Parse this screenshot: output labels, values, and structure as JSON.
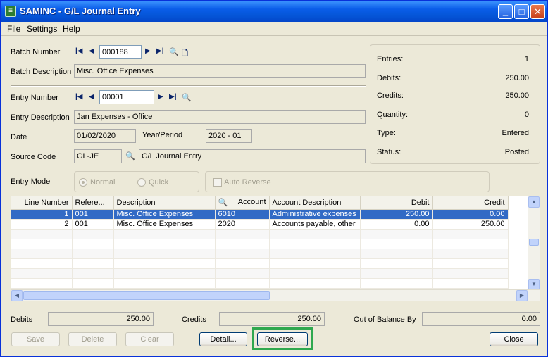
{
  "window": {
    "title": "SAMINC - G/L Journal Entry",
    "icon_text": "≡"
  },
  "menu": [
    "File",
    "Settings",
    "Help"
  ],
  "batch": {
    "number_label": "Batch Number",
    "number": "000188",
    "desc_label": "Batch Description",
    "description": "Misc. Office Expenses"
  },
  "entry": {
    "number_label": "Entry Number",
    "number": "00001",
    "desc_label": "Entry Description",
    "description": "Jan Expenses - Office",
    "date_label": "Date",
    "date": "01/02/2020",
    "period_label": "Year/Period",
    "period": "2020 - 01",
    "source_label": "Source Code",
    "source_code": "GL-JE",
    "source_desc": "G/L Journal Entry",
    "mode_label": "Entry Mode",
    "mode_normal": "Normal",
    "mode_quick": "Quick",
    "auto_reverse": "Auto Reverse"
  },
  "summary": {
    "entries_label": "Entries:",
    "entries": "1",
    "debits_label": "Debits:",
    "debits": "250.00",
    "credits_label": "Credits:",
    "credits": "250.00",
    "quantity_label": "Quantity:",
    "quantity": "0",
    "type_label": "Type:",
    "type": "Entered",
    "status_label": "Status:",
    "status": "Posted"
  },
  "grid": {
    "headers": [
      "Line Number",
      "Refere...",
      "Description",
      "Account",
      "Account Description",
      "Debit",
      "Credit"
    ],
    "rows": [
      [
        "1",
        "001",
        "Misc. Office Expenses",
        "6010",
        "Administrative expenses",
        "250.00",
        "0.00"
      ],
      [
        "2",
        "001",
        "Misc. Office Expenses",
        "2020",
        "Accounts payable, other",
        "0.00",
        "250.00"
      ]
    ]
  },
  "totals": {
    "debits_label": "Debits",
    "debits": "250.00",
    "credits_label": "Credits",
    "credits": "250.00",
    "oob_label": "Out of Balance By",
    "oob": "0.00"
  },
  "buttons": {
    "save": "Save",
    "delete": "Delete",
    "clear": "Clear",
    "detail": "Detail...",
    "reverse": "Reverse...",
    "close": "Close"
  },
  "colors": {
    "highlight": "#2fa84f",
    "selection": "#316ac5",
    "titlebar": "#0556d8"
  }
}
